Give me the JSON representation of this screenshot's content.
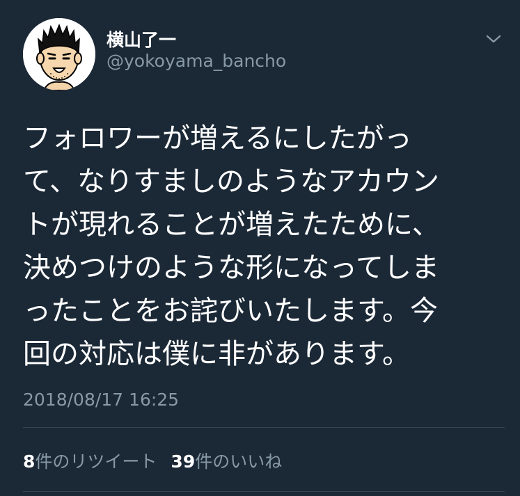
{
  "tweet": {
    "author": {
      "display_name": "横山了一",
      "handle": "@yokoyama_bancho",
      "avatar_icon": "cartoon-face-avatar"
    },
    "body_lines": [
      "フォロワーが増えるにしたがっ",
      "て、なりすましのようなアカウン",
      "トが現れることが増えたために、",
      "決めつけのような形になってしま",
      "ったことをお詫びいたします。今",
      "回の対応は僕に非があります。"
    ],
    "timestamp": "2018/08/17 16:25",
    "stats": {
      "retweet_count": "8",
      "retweet_label": "件のリツイート",
      "like_count": "39",
      "like_label": "件のいいね"
    },
    "menu_icon": "chevron-down-icon"
  },
  "colors": {
    "background": "#1b2836",
    "primary_text": "#ffffff",
    "secondary_text": "#8899a6",
    "divider": "#38444d"
  }
}
